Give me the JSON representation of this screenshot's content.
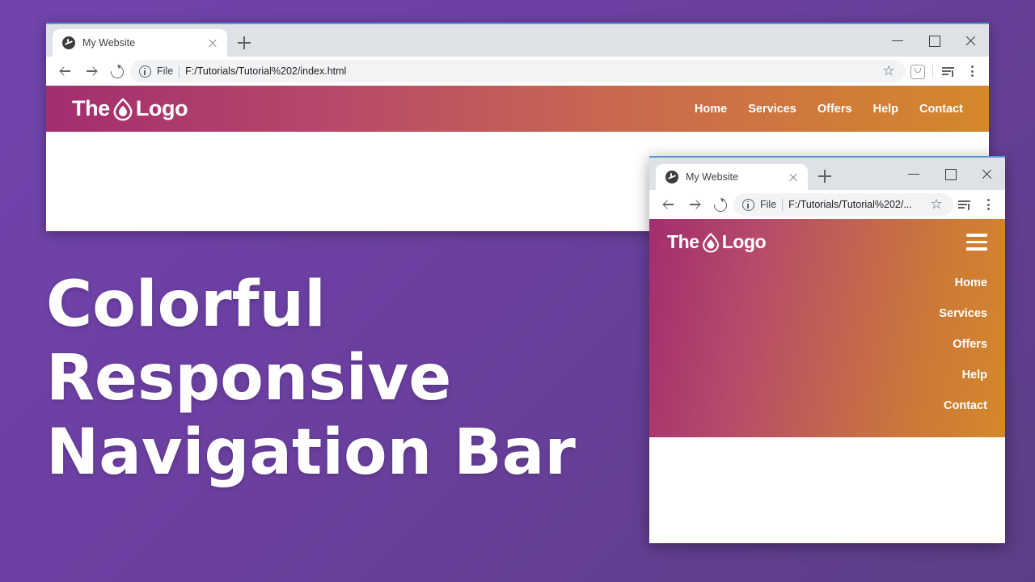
{
  "headline": {
    "line1": "Colorful",
    "line2": "Responsive",
    "line3": "Navigation Bar"
  },
  "colors": {
    "background_purple": "#6b3fa0",
    "gradient_start": "#a32d6e",
    "gradient_end": "#d4882a",
    "nav_text": "#ffffff"
  },
  "desktop_window": {
    "tab": {
      "title": "My Website",
      "favicon": "globe-icon",
      "close": "close-icon",
      "new_tab": "plus-icon"
    },
    "window_controls": {
      "minimize": "minimize-icon",
      "maximize": "maximize-icon",
      "close": "close-icon"
    },
    "toolbar": {
      "back": "back-arrow-icon",
      "forward": "forward-arrow-icon",
      "reload": "reload-icon",
      "security_icon": "info-circle-icon",
      "scheme_label": "File",
      "url": "F:/Tutorials/Tutorial%202/index.html",
      "bookmark": "star-icon",
      "extension": "boxed-icon",
      "reading_list": "reading-list-icon",
      "menu": "three-dots-icon"
    },
    "navbar": {
      "logo_prefix": "The",
      "logo_mark": "flame-drop-icon",
      "logo_suffix": "Logo",
      "links": [
        "Home",
        "Services",
        "Offers",
        "Help",
        "Contact"
      ]
    }
  },
  "mobile_window": {
    "tab": {
      "title": "My Website",
      "favicon": "globe-icon",
      "close": "close-icon",
      "new_tab": "plus-icon"
    },
    "window_controls": {
      "minimize": "minimize-icon",
      "maximize": "maximize-icon",
      "close": "close-icon"
    },
    "toolbar": {
      "back": "back-arrow-icon",
      "forward": "forward-arrow-icon",
      "reload": "reload-icon",
      "security_icon": "info-circle-icon",
      "scheme_label": "File",
      "url": "F:/Tutorials/Tutorial%202/...",
      "bookmark": "star-icon",
      "reading_list": "reading-list-icon",
      "menu": "three-dots-icon"
    },
    "navbar": {
      "logo_prefix": "The",
      "logo_mark": "flame-drop-icon",
      "logo_suffix": "Logo",
      "hamburger": "hamburger-menu-icon",
      "links": [
        "Home",
        "Services",
        "Offers",
        "Help",
        "Contact"
      ]
    }
  }
}
